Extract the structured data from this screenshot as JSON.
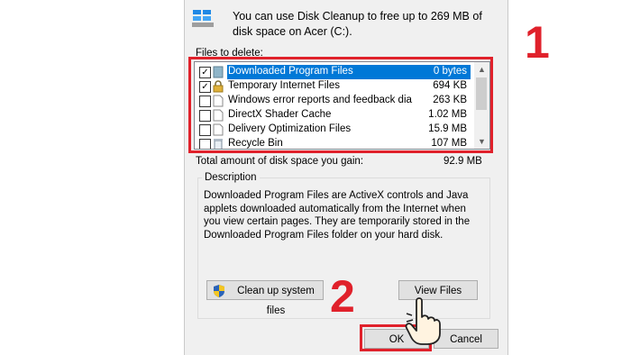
{
  "header": {
    "text": "You can use Disk Cleanup to free up to 269 MB of disk space on Acer (C:).",
    "icon": "drive-cleanup-icon"
  },
  "files_label": "Files to delete:",
  "files": [
    {
      "name": "Downloaded Program Files",
      "size": "0 bytes",
      "checked": true,
      "selected": true,
      "icon": "folder-file-icon"
    },
    {
      "name": "Temporary Internet Files",
      "size": "694 KB",
      "checked": true,
      "selected": false,
      "icon": "lock-icon"
    },
    {
      "name": "Windows error reports and feedback dia...",
      "size": "263 KB",
      "checked": false,
      "selected": false,
      "icon": "document-icon"
    },
    {
      "name": "DirectX Shader Cache",
      "size": "1.02 MB",
      "checked": false,
      "selected": false,
      "icon": "document-icon"
    },
    {
      "name": "Delivery Optimization Files",
      "size": "15.9 MB",
      "checked": false,
      "selected": false,
      "icon": "document-icon"
    },
    {
      "name": "Recycle Bin",
      "size": "107 MB",
      "checked": false,
      "selected": false,
      "icon": "recycle-bin-icon"
    }
  ],
  "total": {
    "label": "Total amount of disk space you gain:",
    "value": "92.9 MB"
  },
  "description": {
    "title": "Description",
    "text": "Downloaded Program Files are ActiveX controls and Java applets downloaded automatically from the Internet when you view certain pages. They are temporarily stored in the Downloaded Program Files folder on your hard disk."
  },
  "buttons": {
    "cleanup": "Clean up system files",
    "view_files": "View Files",
    "ok": "OK",
    "cancel": "Cancel"
  },
  "annotations": {
    "step1": "1",
    "step2": "2",
    "color": "#e0212b"
  },
  "colors": {
    "selection": "#0078d7",
    "dialog_bg": "#f0f0f0"
  }
}
